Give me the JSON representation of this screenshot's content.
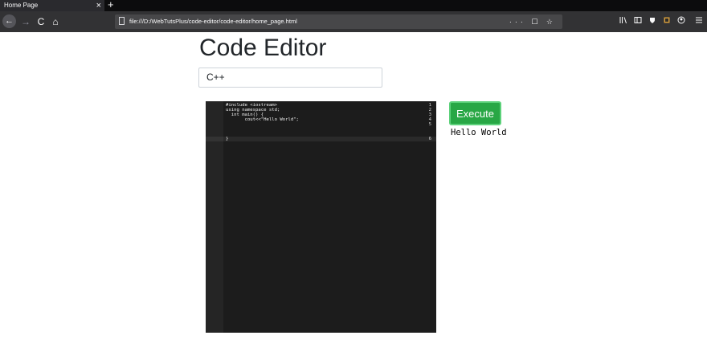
{
  "browser": {
    "tab_title": "Home Page",
    "tab_close": "×",
    "new_tab": "+",
    "back": "←",
    "forward": "→",
    "reload": "C",
    "home": "⌂",
    "url": "file:///D:/WebTutsPlus/code-editor/code-editor/home_page.html",
    "url_actions": "··· ☐ ☆",
    "toolbar_icons": [
      "library-icon",
      "sidebar-icon",
      "shield-icon",
      "extension-icon",
      "account-icon",
      "menu-icon"
    ]
  },
  "page": {
    "title": "Code Editor",
    "language_value": "C++",
    "execute_label": "Execute",
    "output": "Hello World"
  },
  "editor": {
    "line_numbers": [
      "1",
      "2",
      "3",
      "4",
      "5",
      "6"
    ],
    "lines": [
      "#include <iostream>",
      "using namespace std;",
      "  int main() {",
      "       cout<<\"Hello World\";",
      "",
      "}"
    ],
    "colors": {
      "background": "#1c1c1c",
      "gutter": "#252525",
      "text": "#f0f0f0"
    }
  },
  "colors": {
    "execute_button": "#28a745",
    "browser_tabbar": "#0c0c0d",
    "browser_navbar": "#323234"
  }
}
